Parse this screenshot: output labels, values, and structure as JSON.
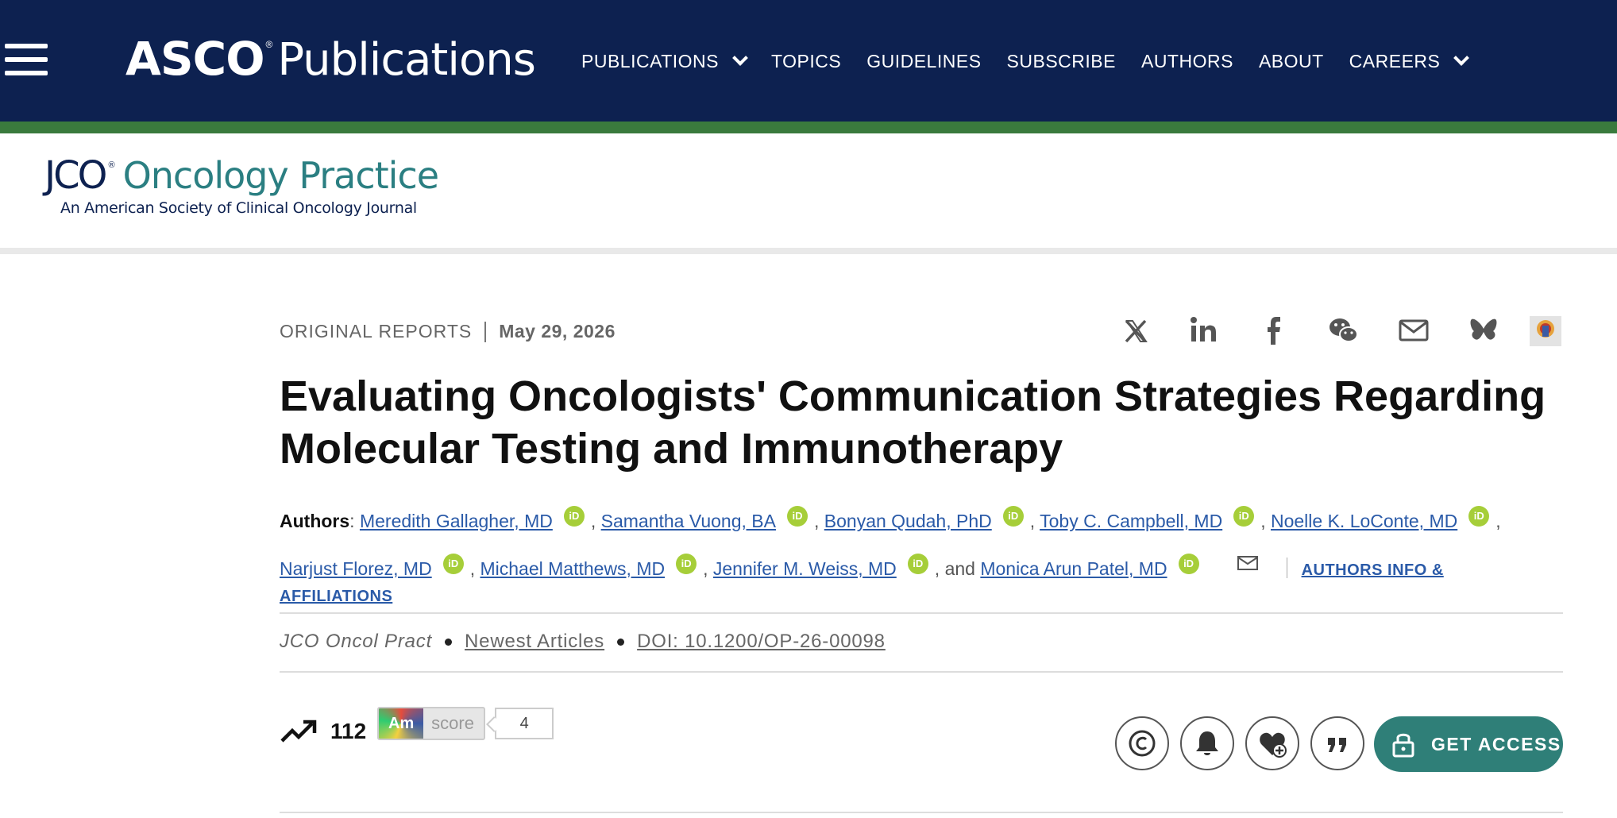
{
  "top_nav": {
    "brand_asco": "ASCO",
    "brand_reg": "®",
    "brand_publications": "Publications",
    "items": [
      {
        "label": "PUBLICATIONS",
        "has_dropdown": true
      },
      {
        "label": "TOPICS",
        "has_dropdown": false
      },
      {
        "label": "GUIDELINES",
        "has_dropdown": false
      },
      {
        "label": "SUBSCRIBE",
        "has_dropdown": false
      },
      {
        "label": "AUTHORS",
        "has_dropdown": false
      },
      {
        "label": "ABOUT",
        "has_dropdown": false
      },
      {
        "label": "CAREERS",
        "has_dropdown": true
      }
    ]
  },
  "journal": {
    "abbr": "JCO",
    "reg": "®",
    "name": "Oncology Practice",
    "tagline": "An American Society of Clinical Oncology Journal"
  },
  "article": {
    "type": "ORIGINAL REPORTS",
    "date": "May 29, 2026",
    "title": "Evaluating Oncologists' Communication Strategies Regarding Molecular Testing and Immunotherapy",
    "authors_label": "Authors",
    "authors": [
      {
        "name": "Meredith Gallagher, MD"
      },
      {
        "name": "Samantha Vuong, BA"
      },
      {
        "name": "Bonyan Qudah, PhD"
      },
      {
        "name": "Toby C. Campbell, MD"
      },
      {
        "name": "Noelle K. LoConte, MD"
      },
      {
        "name": "Narjust Florez, MD"
      },
      {
        "name": "Michael Matthews, MD"
      },
      {
        "name": "Jennifer M. Weiss, MD"
      },
      {
        "name": "Monica Arun Patel, MD"
      }
    ],
    "orcid_label": "iD",
    "and_text": ", and",
    "affiliations_part1": "AUTHORS INFO &",
    "affiliations_part2": "AFFILIATIONS",
    "journal_abbr": "JCO Oncol Pract",
    "section_link": "Newest Articles",
    "doi": "DOI: 10.1200/OP-26-00098"
  },
  "metrics": {
    "views": "112",
    "altmetric_am": "Am",
    "altmetric_score_label": "score",
    "altmetric_score": "4"
  },
  "actions": {
    "get_access_label": "GET ACCESS"
  },
  "colors": {
    "nav_bg": "#0d2150",
    "green_strip": "#3a7a3d",
    "journal_teal": "#2b7f82",
    "link_blue": "#2a5aa8",
    "get_access_bg": "#2f7f78",
    "orcid_green": "#a6ce39"
  },
  "icons": {
    "share": [
      "x-icon",
      "linkedin-icon",
      "facebook-icon",
      "wechat-icon",
      "email-icon",
      "bluesky-icon",
      "mendeley-icon"
    ],
    "actions": [
      "copyright-icon",
      "bell-icon",
      "favorite-add-icon",
      "cite-quote-icon",
      "lock-icon"
    ]
  }
}
